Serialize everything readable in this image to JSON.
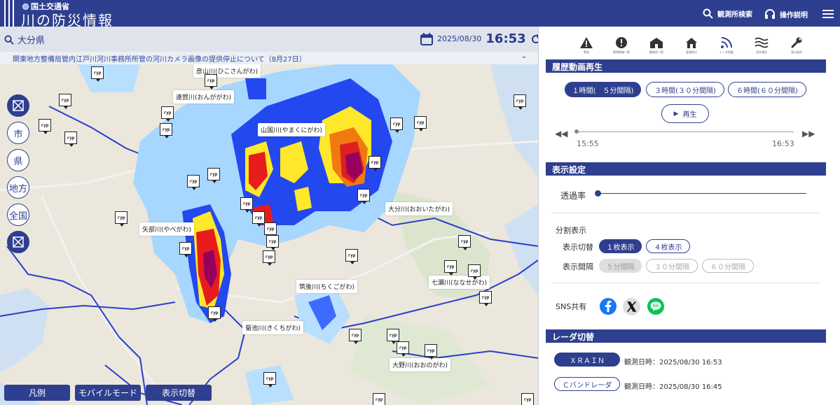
{
  "header": {
    "ministry": "国土交通省",
    "title": "川の防災情報",
    "search_label": "観測所検索",
    "help_label": "操作説明"
  },
  "subbar": {
    "prefecture": "大分県",
    "date": "2025/08/30",
    "time": "16:53"
  },
  "notice": {
    "text": "関東地方整備局管内江戸川河川事務所所管の河川カメラ画像の提供停止について（8月27日）"
  },
  "map": {
    "labels": {
      "hikosan": "彦山川(ひこさんがわ)",
      "ongagawa": "遠賀川(おんががわ)",
      "yamakuni": "山国川(やまくにがわ)",
      "oita": "大分川(おおいたがわ)",
      "yabe": "矢部川(やべがわ)",
      "chikugo": "筑後川(ちくごがわ)",
      "nanase": "七瀬川(ななせがわ)",
      "kikuchi": "菊池川(きくちがわ)",
      "ono": "大野川(おおのがわ)"
    },
    "tools": [
      "市",
      "県",
      "地方",
      "全国"
    ],
    "camera_text": "ryp"
  },
  "bottom_buttons": {
    "legend": "凡例",
    "mobile": "モバイルモード",
    "display_toggle": "表示切替"
  },
  "panel": {
    "icons": [
      "警戒",
      "異常情報一覧",
      "観測所一覧",
      "登録地点",
      "レーダ雨量",
      "浸水想定",
      "表示設定"
    ],
    "history": {
      "title": "履歴動画再生",
      "opt1": "１時間(　５分間隔)",
      "opt2": "３時間(３０分間隔)",
      "opt3": "６時間(６０分間隔)",
      "play": "再生",
      "start": "15:55",
      "end": "16:53"
    },
    "display": {
      "title": "表示設定",
      "opacity": "透過率",
      "split_title": "分割表示",
      "toggle_label": "表示切替",
      "one": "１枚表示",
      "four": "４枚表示",
      "interval_label": "表示間隔",
      "i5": "５分間隔",
      "i30": "３０分間隔",
      "i60": "６０分間隔",
      "sns": "SNS共有"
    },
    "radar": {
      "title": "レーダ切替",
      "xrain": "ＸＲＡＩＮ",
      "xrain_time": "観測日時：2025/08/30 16:53",
      "cband": "Ｃバンドレーダ",
      "cband_time": "観測日時：2025/08/30 16:45"
    }
  },
  "colors": {
    "primary": "#2e3f8f",
    "radar_light": "#9fd2ff",
    "radar_blue": "#2244ee",
    "radar_yellow": "#ffee22",
    "radar_red": "#dd2222",
    "radar_purple": "#990066",
    "facebook": "#1877f2",
    "line": "#06c755"
  }
}
